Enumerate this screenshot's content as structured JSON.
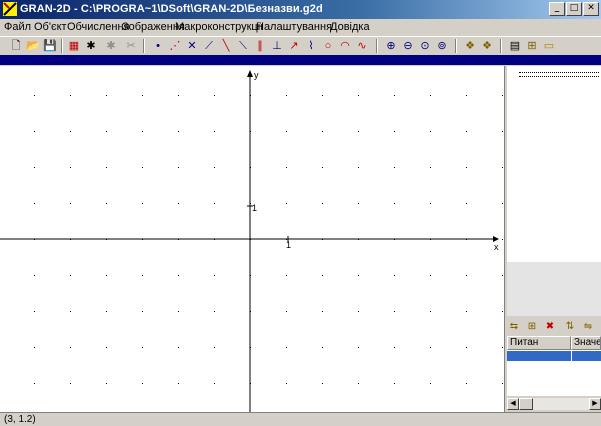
{
  "window": {
    "title": "GRAN-2D - C:\\PROGRA~1\\DSoft\\GRAN-2D\\Безназви.g2d",
    "buttons": {
      "minimize": "_",
      "maximize": "□",
      "close": "✕"
    }
  },
  "menu": [
    {
      "label": "Файл"
    },
    {
      "label": "Об'єкт"
    },
    {
      "label": "Обчислення"
    },
    {
      "label": "Зображення"
    },
    {
      "label": "Макроконструкції"
    },
    {
      "label": "Налаштування"
    },
    {
      "label": "Довідка"
    }
  ],
  "toolbar": [
    {
      "icon": "new-file-icon",
      "glyph": "🗋"
    },
    {
      "icon": "open-folder-icon",
      "glyph": "📂"
    },
    {
      "icon": "save-icon",
      "glyph": "💾"
    },
    {
      "icon": "calculator-icon",
      "glyph": "▦"
    },
    {
      "icon": "settings-gear-icon",
      "glyph": "✱"
    },
    {
      "icon": "disabled-gear-icon",
      "glyph": "✱"
    },
    {
      "icon": "scissors-icon",
      "glyph": "✂"
    },
    {
      "icon": "point-icon",
      "glyph": "•"
    },
    {
      "icon": "point-on-line-icon",
      "glyph": "⋰"
    },
    {
      "icon": "intersection-icon",
      "glyph": "✕"
    },
    {
      "icon": "line-icon",
      "glyph": "⟋"
    },
    {
      "icon": "segment-icon",
      "glyph": "╲"
    },
    {
      "icon": "ray-icon",
      "glyph": "⟍"
    },
    {
      "icon": "parallel-icon",
      "glyph": "∥"
    },
    {
      "icon": "perpendicular-icon",
      "glyph": "⊥"
    },
    {
      "icon": "vector-icon",
      "glyph": "↗"
    },
    {
      "icon": "polyline-icon",
      "glyph": "⌇"
    },
    {
      "icon": "circle-icon",
      "glyph": "○"
    },
    {
      "icon": "arc-icon",
      "glyph": "◠"
    },
    {
      "icon": "curve-icon",
      "glyph": "∿"
    },
    {
      "icon": "zoom-in-icon",
      "glyph": "⊕"
    },
    {
      "icon": "zoom-out-icon",
      "glyph": "⊖"
    },
    {
      "icon": "zoom-fit-icon",
      "glyph": "⊙"
    },
    {
      "icon": "zoom-reset-icon",
      "glyph": "⊚"
    },
    {
      "icon": "macro-run-icon",
      "glyph": "❖"
    },
    {
      "icon": "macro-edit-icon",
      "glyph": "❖"
    },
    {
      "icon": "table-icon",
      "glyph": "▤"
    },
    {
      "icon": "graph-table-icon",
      "glyph": "⊞"
    },
    {
      "icon": "folder-graph-icon",
      "glyph": "▭"
    }
  ],
  "canvas": {
    "axis_x_label": "x",
    "axis_y_label": "y",
    "unit_x_label": "1",
    "unit_y_label": "1"
  },
  "right_panel": {
    "tools": [
      {
        "icon": "macro-a-icon",
        "glyph": "⇆"
      },
      {
        "icon": "macro-b-icon",
        "glyph": "⊞"
      },
      {
        "icon": "macro-delete-icon",
        "glyph": "✖"
      },
      {
        "icon": "macro-c-icon",
        "glyph": "⇅"
      },
      {
        "icon": "macro-d-icon",
        "glyph": "⇋"
      }
    ],
    "table_headers": [
      "Питан",
      "Значен"
    ]
  },
  "status": {
    "coords": "(3, 1.2)"
  },
  "colors": {
    "title_gradient_start": "#0a246a",
    "selection_blue": "#316ac5",
    "toolbar_red": "#c00000"
  }
}
